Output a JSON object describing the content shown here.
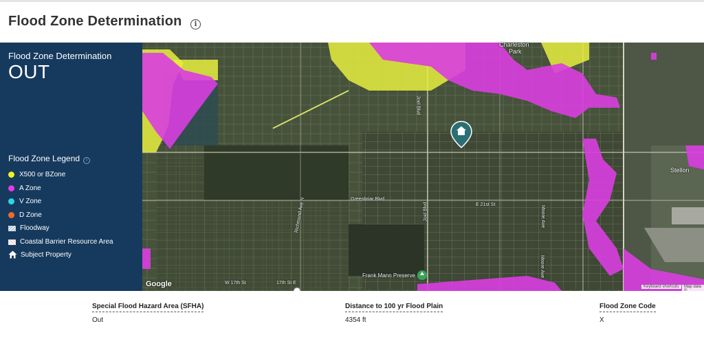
{
  "header": {
    "title": "Flood Zone Determination"
  },
  "sidebar": {
    "determination_title": "Flood Zone Determination",
    "determination_value": "OUT",
    "legend_title": "Flood Zone Legend",
    "legend_items": [
      {
        "label": "X500 or BZone",
        "color": "#f0f020",
        "icon": "yellow-dot"
      },
      {
        "label": "A Zone",
        "color": "#e23be8",
        "icon": "magenta-dot"
      },
      {
        "label": "V Zone",
        "color": "#2ed6e8",
        "icon": "cyan-dot"
      },
      {
        "label": "D Zone",
        "color": "#f06a2a",
        "icon": "orange-dot"
      },
      {
        "label": "Floodway",
        "icon": "floodway-hatch-icon"
      },
      {
        "label": "Coastal Barrier Resource Area",
        "icon": "coastal-hatch-icon"
      },
      {
        "label": "Subject Property",
        "icon": "home-icon"
      }
    ]
  },
  "map": {
    "labels": {
      "charleston": "Charleston",
      "park": "Park",
      "stellon": "Stellon",
      "greenbriar": "Greenbriar Blvd",
      "e21st": "E 21st St",
      "joel1": "Joel Blvd",
      "joel2": "Joel Blvd",
      "richmond": "Richmond Ave N",
      "moore1": "Moore Ave",
      "moore2": "Moore Ave",
      "w17th": "W 17th St",
      "s17th": "17th St E",
      "frank_mann": "Frank Mann Preserve"
    },
    "google": "Google",
    "shortcuts": "Keyboard shortcuts",
    "map_data": "Map data ©"
  },
  "details": {
    "sfha_label": "Special Flood Hazard Area (SFHA)",
    "sfha_value": "Out",
    "distance_label": "Distance to 100 yr Flood Plain",
    "distance_value": "4354 ft",
    "code_label": "Flood Zone Code",
    "code_value": "X"
  }
}
